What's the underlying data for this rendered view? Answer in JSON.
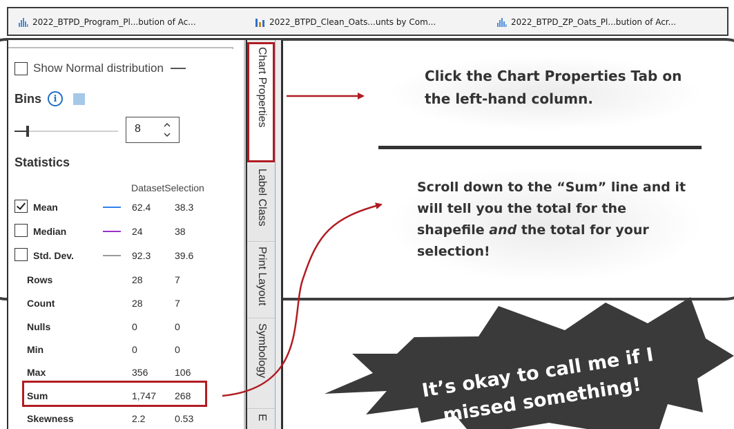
{
  "tabs": [
    {
      "title": "2022_BTPD_Program_Pl...bution of Ac...",
      "icon": "histogram-icon"
    },
    {
      "title": "2022_BTPD_Clean_Oats...unts by Com...",
      "icon": "bar-chart-icon"
    },
    {
      "title": "2022_BTPD_ZP_Oats_Pl...bution of Acr...",
      "icon": "histogram-icon"
    }
  ],
  "pane": {
    "normal_label": "Show Normal distribution",
    "bins_label": "Bins",
    "bins_value": "8",
    "statistics_label": "Statistics",
    "col_dataset": "Dataset",
    "col_selection": "Selection",
    "rows": [
      {
        "label": "Mean",
        "dataset": "62.4",
        "selection": "38.3",
        "checkbox": true,
        "checked": true,
        "color": "#2f80ed"
      },
      {
        "label": "Median",
        "dataset": "24",
        "selection": "38",
        "checkbox": true,
        "checked": false,
        "color": "#9b30c8"
      },
      {
        "label": "Std. Dev.",
        "dataset": "92.3",
        "selection": "39.6",
        "checkbox": true,
        "checked": false,
        "color": "#9a9a9a"
      },
      {
        "label": "Rows",
        "dataset": "28",
        "selection": "7"
      },
      {
        "label": "Count",
        "dataset": "28",
        "selection": "7"
      },
      {
        "label": "Nulls",
        "dataset": "0",
        "selection": "0"
      },
      {
        "label": "Min",
        "dataset": "0",
        "selection": "0"
      },
      {
        "label": "Max",
        "dataset": "356",
        "selection": "106"
      },
      {
        "label": "Sum",
        "dataset": "1,747",
        "selection": "268"
      },
      {
        "label": "Skewness",
        "dataset": "2.2",
        "selection": "0.53"
      }
    ]
  },
  "side_tabs": [
    "Chart Properties",
    "Label Class",
    "Print Layout",
    "Symbology",
    "E"
  ],
  "notes": {
    "note1": "Click the Chart Properties Tab on the left-hand column.",
    "note2_a": "Scroll down to the “Sum” line and it will tell you the total for the shapefile ",
    "note2_em": "and",
    "note2_b": " the total for your selection!",
    "burst_line1": "It’s okay to call me if I",
    "burst_line2": "missed something!"
  },
  "colors": {
    "highlight": "#b01c22",
    "mean_line": "#2f80ed",
    "median_line": "#9b30c8",
    "std_line": "#9a9a9a"
  }
}
